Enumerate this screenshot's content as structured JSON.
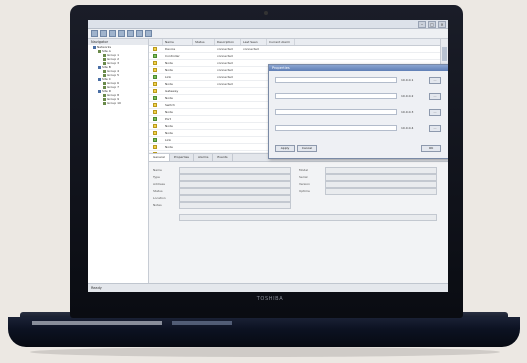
{
  "device": {
    "brand": "TOSHIBA"
  },
  "app": {
    "tree_title": "Navigator",
    "tree_items": [
      {
        "label": "Networks",
        "indent": 1,
        "color": "blue"
      },
      {
        "label": "Site A",
        "indent": 2,
        "color": "green"
      },
      {
        "label": "Group 1",
        "indent": 3,
        "color": "green"
      },
      {
        "label": "Group 2",
        "indent": 3,
        "color": "green"
      },
      {
        "label": "Group 3",
        "indent": 3,
        "color": "green"
      },
      {
        "label": "Site B",
        "indent": 2,
        "color": "blue"
      },
      {
        "label": "Group 4",
        "indent": 3,
        "color": "green"
      },
      {
        "label": "Group 5",
        "indent": 3,
        "color": "green"
      },
      {
        "label": "Site C",
        "indent": 2,
        "color": "blue"
      },
      {
        "label": "Group 6",
        "indent": 3,
        "color": "green"
      },
      {
        "label": "Group 7",
        "indent": 3,
        "color": "green"
      },
      {
        "label": "Site D",
        "indent": 2,
        "color": "blue"
      },
      {
        "label": "Group 8",
        "indent": 3,
        "color": "green"
      },
      {
        "label": "Group 9",
        "indent": 3,
        "color": "green"
      },
      {
        "label": "Group 10",
        "indent": 3,
        "color": "green"
      }
    ],
    "grid_columns": [
      "",
      "Name",
      "Status",
      "Description",
      "Last Seen",
      "Current Alarm"
    ],
    "grid_rows": [
      [
        "",
        "Device",
        "",
        "connected",
        "connected",
        ""
      ],
      [
        "",
        "Controller",
        "",
        "connected",
        "",
        ""
      ],
      [
        "",
        "Node",
        "",
        "connected",
        "",
        ""
      ],
      [
        "",
        "Node",
        "",
        "connected",
        "",
        ""
      ],
      [
        "",
        "Link",
        "",
        "connected",
        "",
        ""
      ],
      [
        "",
        "Node",
        "",
        "connected",
        "",
        ""
      ],
      [
        "",
        "Gateway",
        "",
        "",
        "",
        ""
      ],
      [
        "",
        "Node",
        "",
        "",
        "",
        ""
      ],
      [
        "",
        "Switch",
        "",
        "",
        "",
        ""
      ],
      [
        "",
        "Node",
        "",
        "",
        "",
        ""
      ],
      [
        "",
        "Port",
        "",
        "",
        "",
        ""
      ],
      [
        "",
        "Node",
        "",
        "",
        "",
        ""
      ],
      [
        "",
        "Node",
        "",
        "",
        "",
        ""
      ],
      [
        "",
        "Link",
        "",
        "",
        "",
        ""
      ],
      [
        "",
        "Node",
        "",
        "",
        "",
        ""
      ],
      [
        "",
        "Router",
        "",
        "connected",
        "connected",
        ""
      ]
    ],
    "dialog": {
      "title": "Properties",
      "values": [
        "10.0.0.1",
        "10.0.0.2",
        "10.0.0.3",
        "10.0.0.4"
      ],
      "buttons": [
        "Apply",
        "Cancel",
        "OK"
      ]
    },
    "detail_tabs": [
      "General",
      "Properties",
      "Alarms",
      "Events"
    ],
    "detail_labels_left": [
      "Name",
      "Type",
      "Address",
      "Status",
      "Location",
      "Notes"
    ],
    "detail_labels_right": [
      "Model",
      "Serial",
      "Version",
      "Uptime"
    ],
    "status_text": "Ready"
  }
}
